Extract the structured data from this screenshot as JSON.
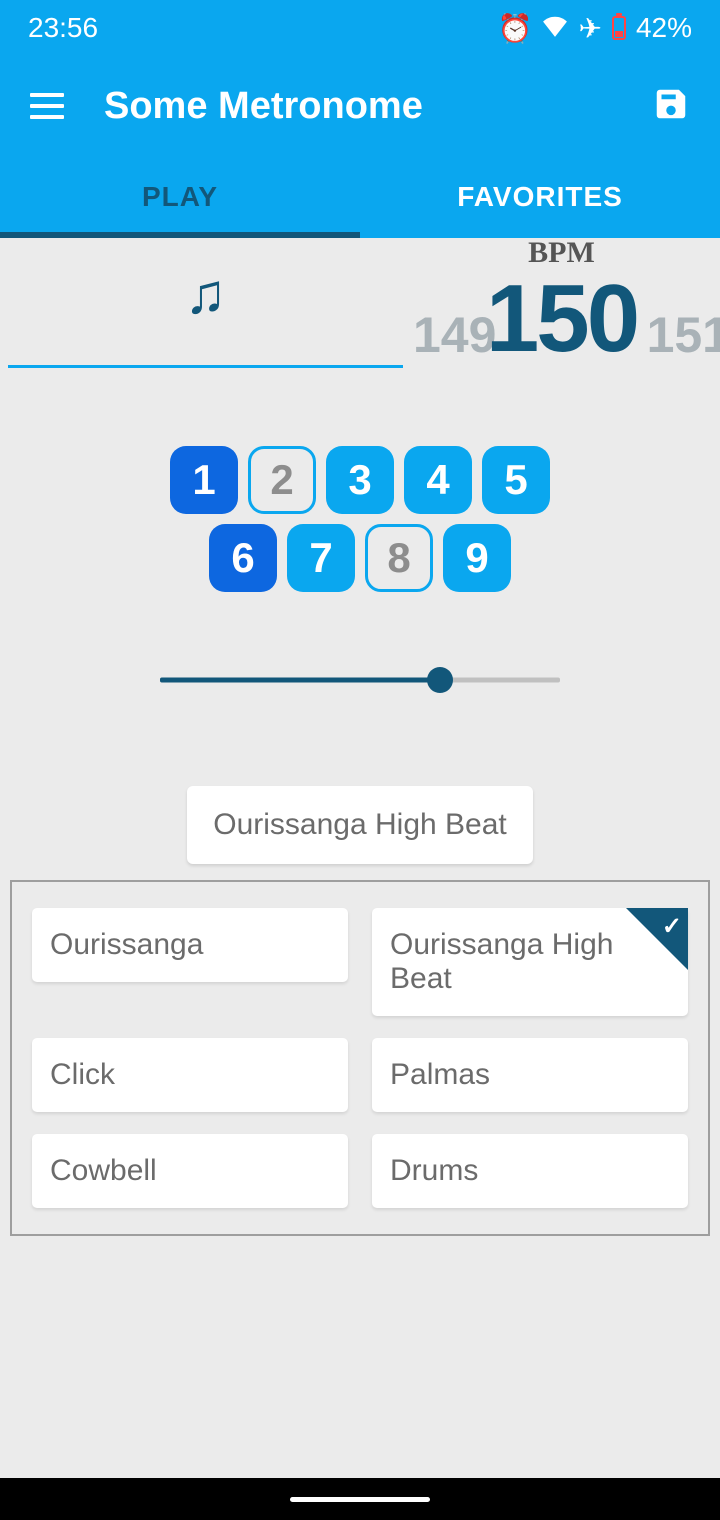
{
  "status": {
    "time": "23:56",
    "battery": "42%"
  },
  "app": {
    "title": "Some Metronome"
  },
  "tabs": {
    "play": "PLAY",
    "favorites": "FAVORITES"
  },
  "bpm": {
    "label": "BPM",
    "prev": "149",
    "current": "150",
    "next": "151"
  },
  "beats": [
    "1",
    "2",
    "3",
    "4",
    "5",
    "6",
    "7",
    "8",
    "9"
  ],
  "sound": {
    "selected": "Ourissanga High Beat",
    "options": [
      "Ourissanga",
      "Ourissanga High Beat",
      "Click",
      "Palmas",
      "Cowbell",
      "Drums"
    ]
  }
}
